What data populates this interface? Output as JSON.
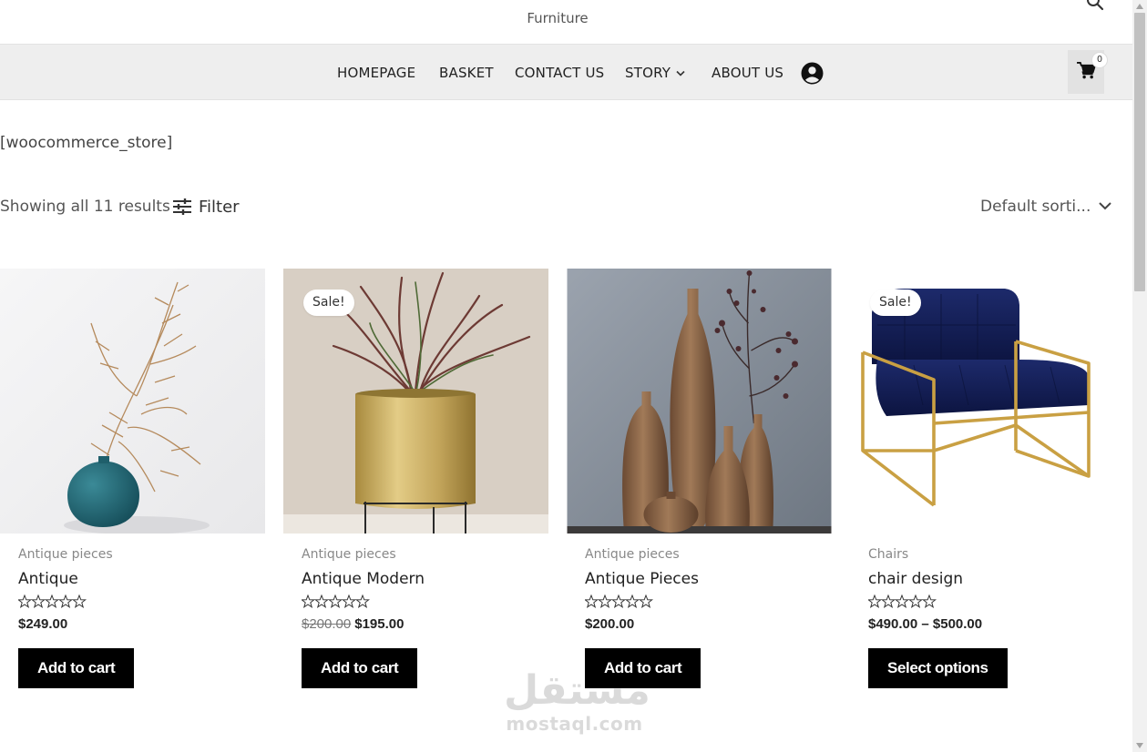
{
  "site": {
    "title": "Furniture"
  },
  "nav": {
    "items": [
      {
        "label": "HOMEPAGE"
      },
      {
        "label": "BASKET"
      },
      {
        "label": "CONTACT US"
      },
      {
        "label": "STORY"
      },
      {
        "label": "ABOUT US"
      }
    ],
    "cart_count": "0"
  },
  "content": {
    "shortcode": "[woocommerce_store]",
    "results_text": "Showing all 11 results",
    "filter_label": "Filter",
    "sort_label": "Default sorti..."
  },
  "products": [
    {
      "category": "Antique pieces",
      "title": "Antique",
      "price": "$249.00",
      "old_price": "",
      "button": "Add to cart",
      "sale": ""
    },
    {
      "category": "Antique pieces",
      "title": "Antique Modern",
      "price": "$195.00",
      "old_price": "$200.00",
      "button": "Add to cart",
      "sale": "Sale!"
    },
    {
      "category": "Antique pieces",
      "title": "Antique Pieces",
      "price": "$200.00",
      "old_price": "",
      "button": "Add to cart",
      "sale": ""
    },
    {
      "category": "Chairs",
      "title": "chair design",
      "price": "$490.00 – $500.00",
      "old_price": "",
      "button": "Select options",
      "sale": "Sale!"
    }
  ],
  "watermark": {
    "arabic": "مستقل",
    "latin": "mostaql.com"
  },
  "icons": {
    "search": "search-icon",
    "account": "account-circle-icon",
    "cart": "shopping-cart-icon",
    "filter": "filter-sliders-icon",
    "sort": "chevron-down-icon",
    "rating": "star-outline-icon"
  },
  "colors": {
    "nav_bg": "#eeeeee",
    "button_bg": "#000000",
    "text": "#3a3a3a",
    "muted": "#888888"
  }
}
